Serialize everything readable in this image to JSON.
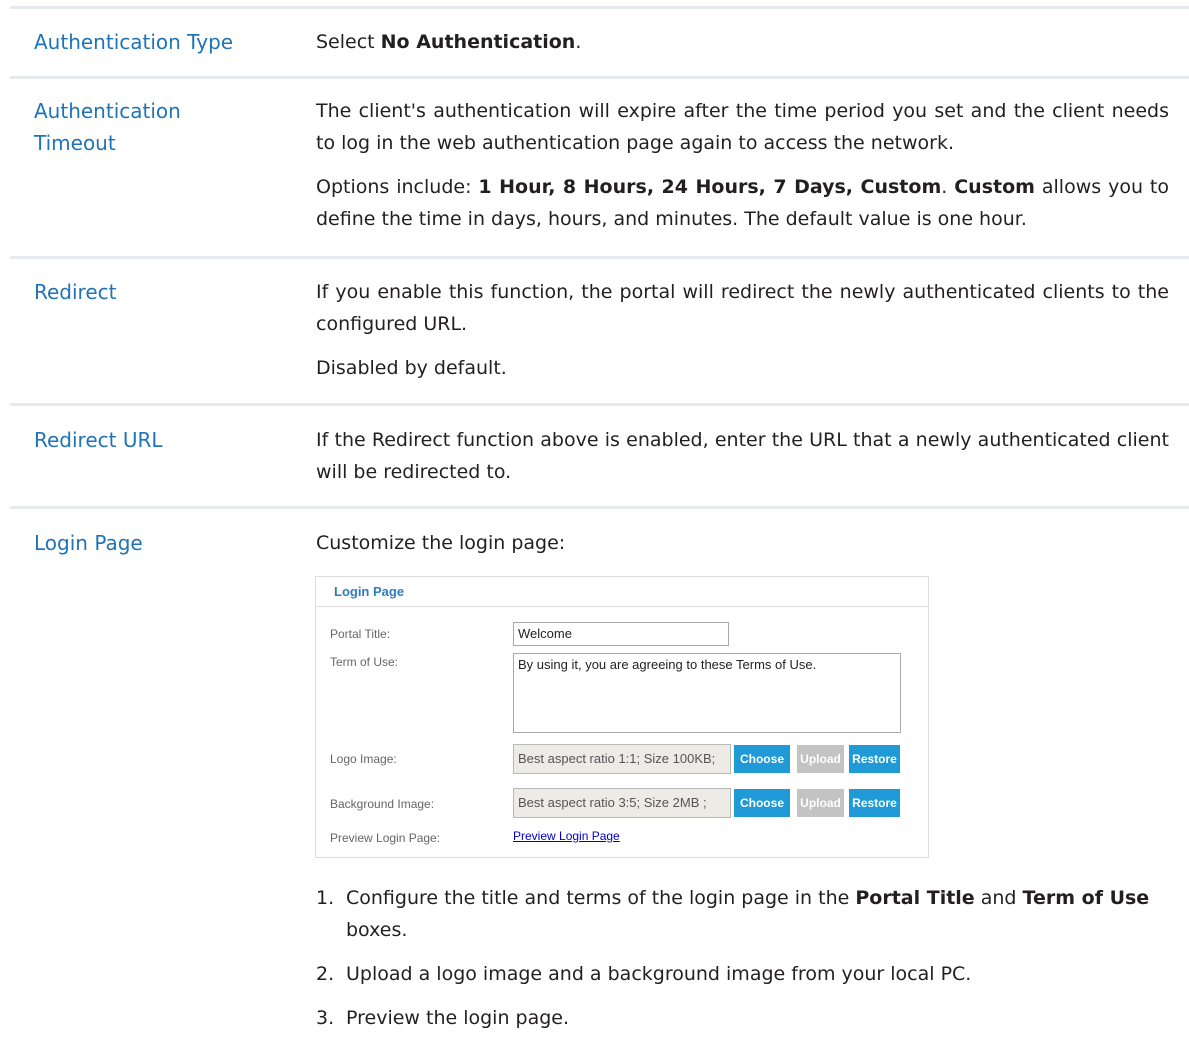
{
  "rows": [
    {
      "term": "Authentication Type",
      "desc_pre": "Select ",
      "desc_bold": "No Authentication",
      "desc_post": "."
    },
    {
      "term_line1": "Authentication",
      "term_line2": "Timeout",
      "p1": "The client's authentication will expire after the time period you set and the client needs to log in the web authentication page again to access the network.",
      "p2_pre": "Options include: ",
      "p2_bold1": "1 Hour, 8 Hours, 24 Hours, 7 Days, Custom",
      "p2_mid": ". ",
      "p2_bold2": "Custom",
      "p2_post": " allows you to define the time in days, hours, and minutes. The default value is one hour."
    },
    {
      "term": "Redirect",
      "p1": "If you enable this function, the portal will redirect the newly authenticated clients to the configured URL.",
      "p2": "Disabled by default."
    },
    {
      "term": "Redirect URL",
      "p1": "If the Redirect function above is enabled, enter the URL that a newly authenticated client will be redirected to."
    },
    {
      "term": "Login Page",
      "intro": "Customize the login page:"
    }
  ],
  "login_panel": {
    "title": "Login Page",
    "portal_title_label": "Portal Title:",
    "portal_title_value": "Welcome",
    "term_label": "Term of Use:",
    "term_value": "By using it, you are agreeing to these Terms of Use.",
    "logo_label": "Logo Image:",
    "logo_hint": "Best aspect ratio 1:1; Size 100KB;",
    "bg_label": "Background Image:",
    "bg_hint": "Best aspect ratio 3:5; Size 2MB ;",
    "choose": "Choose",
    "upload": "Upload",
    "restore": "Restore",
    "preview_label": "Preview Login Page:",
    "preview_link": "Preview Login Page"
  },
  "steps": [
    {
      "num": "1.",
      "pre": "Configure the title and terms of the login page in the ",
      "b1": "Portal Title",
      "mid": " and ",
      "b2": "Term of Use",
      "post": " boxes."
    },
    {
      "num": "2.",
      "text": "Upload a logo image and a background image from your local PC."
    },
    {
      "num": "3.",
      "text": "Preview the login page."
    }
  ],
  "colors": {
    "term": "#1f74b8",
    "rule": "#e6eaee",
    "button_blue": "#1f9ad6",
    "button_gray": "#c3c3c3"
  }
}
